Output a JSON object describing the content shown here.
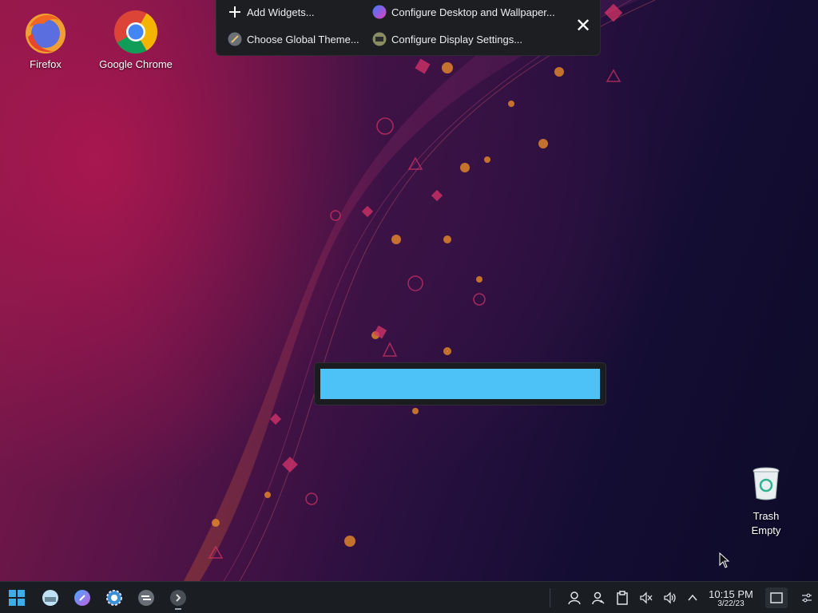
{
  "desktop": {
    "icons": [
      {
        "label": "Firefox"
      },
      {
        "label": "Google Chrome"
      },
      {
        "label": "Trash",
        "sublabel": "Empty"
      }
    ]
  },
  "toolbox": {
    "add_widgets": "Add Widgets...",
    "configure_desktop": "Configure Desktop and Wallpaper...",
    "global_theme": "Choose Global Theme...",
    "display_settings": "Configure Display Settings...",
    "close_icon": "close-icon"
  },
  "runner": {
    "value": "",
    "accent": "#4cc2f7"
  },
  "taskbar": {
    "launchers": [
      "start-menu-icon",
      "file-manager-icon",
      "discover-icon",
      "system-settings-icon",
      "activities-icon",
      "terminal-icon"
    ],
    "tray": [
      "user-icon",
      "users-icon",
      "clipboard-icon",
      "mute-icon",
      "volume-icon",
      "expand-tray-icon"
    ],
    "clock": {
      "time": "10:15 PM",
      "date": "3/22/23"
    },
    "show_desktop": "show-desktop-icon",
    "panel_settings": "panel-settings-icon"
  },
  "colors": {
    "accent": "#4cc2f7",
    "taskbar_bg": "#1a1d22",
    "toolbox_bg": "#1d1e22"
  }
}
